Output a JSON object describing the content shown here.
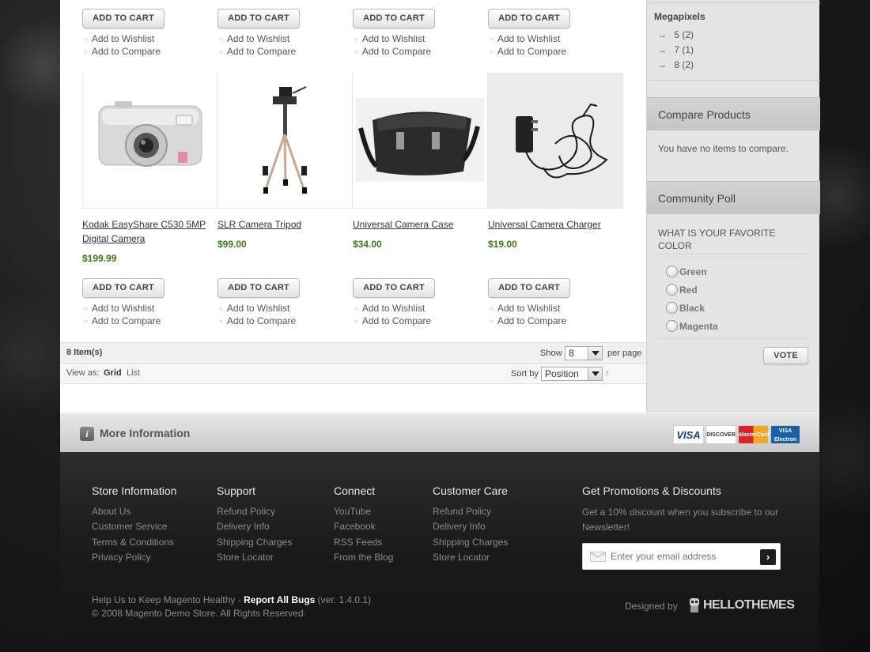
{
  "products": {
    "top_row": [
      {
        "cart_label": "ADD TO CART",
        "wishlist": "Add to Wishlist",
        "compare": "Add to Compare"
      },
      {
        "cart_label": "ADD TO CART",
        "wishlist": "Add to Wishlist",
        "compare": "Add to Compare"
      },
      {
        "cart_label": "ADD TO CART",
        "wishlist": "Add to Wishlist",
        "compare": "Add to Compare"
      },
      {
        "cart_label": "ADD TO CART",
        "wishlist": "Add to Wishlist",
        "compare": "Add to Compare"
      }
    ],
    "bottom_row": [
      {
        "name_line1": "Kodak EasyShare C530 5MP",
        "name_line2": "Digital Camera",
        "price": "$199.99",
        "cart_label": "ADD TO CART",
        "wishlist": "Add to Wishlist",
        "compare": "Add to Compare",
        "image": "camera"
      },
      {
        "name_line1": "SLR Camera Tripod",
        "name_line2": "",
        "price": "$99.00",
        "cart_label": "ADD TO CART",
        "wishlist": "Add to Wishlist",
        "compare": "Add to Compare",
        "image": "tripod"
      },
      {
        "name_line1": "Universal Camera Case",
        "name_line2": "",
        "price": "$34.00",
        "cart_label": "ADD TO CART",
        "wishlist": "Add to Wishlist",
        "compare": "Add to Compare",
        "image": "case"
      },
      {
        "name_line1": "Universal Camera Charger",
        "name_line2": "",
        "price": "$19.00",
        "cart_label": "ADD TO CART",
        "wishlist": "Add to Wishlist",
        "compare": "Add to Compare",
        "image": "charger"
      }
    ]
  },
  "toolbar": {
    "item_count": "8 Item(s)",
    "show_label": "Show",
    "show_value": "8",
    "per_page": "per page",
    "view_as": "View as:",
    "view_grid": "Grid",
    "view_list": "List",
    "sort_by": "Sort by",
    "sort_value": "Position"
  },
  "sidebar": {
    "megapixels_title": "Megapixels",
    "megapixels": [
      "5 (2)",
      "7 (1)",
      "8 (2)"
    ],
    "compare_title": "Compare Products",
    "compare_text": "You have no items to compare.",
    "poll_title": "Community Poll",
    "poll_question_line1": "WHAT IS YOUR FAVORITE",
    "poll_question_line2": "COLOR",
    "poll_options": [
      "Green",
      "Red",
      "Black",
      "Magenta"
    ],
    "vote_label": "VOTE"
  },
  "more_info": {
    "title": "More Information",
    "cards": [
      "VISA",
      "DISCOVER",
      "MasterCard",
      "VISA Electron"
    ]
  },
  "footer": {
    "store_info": {
      "title": "Store Information",
      "links": [
        "About Us",
        "Customer Service",
        "Terms & Conditions",
        "Privacy Policy"
      ]
    },
    "support": {
      "title": "Support",
      "links": [
        "Refund Policy",
        "Delivery Info",
        "Shipping Charges",
        "Store Locator"
      ]
    },
    "connect": {
      "title": "Connect",
      "links": [
        "YouTube",
        "Facebook",
        "RSS Feeds",
        "From the Blog"
      ]
    },
    "customer_care": {
      "title": "Customer Care",
      "links": [
        "Refund Policy",
        "Delivery Info",
        "Shipping Charges",
        "Store Locator"
      ]
    },
    "promo": {
      "title": "Get Promotions & Discounts",
      "text_line1": "Get a 10% discount when you subscribe to our",
      "text_line2": "Newsletter!",
      "email_placeholder": "Enter your email address"
    },
    "help_prefix": "Help Us to Keep Magento Healthy - ",
    "help_link": "Report All Bugs",
    "help_version": " (ver. 1.4.0.1)",
    "copyright": "© 2008 Magento Demo Store. All Rights Reserved.",
    "designed_by": "Designed by",
    "brand": "HELLOTHEMES"
  },
  "colors": {
    "price_green": "#3a7a18",
    "footer_bg": "#1e1e1e",
    "sidebar_bg": "#e4e4e4"
  }
}
